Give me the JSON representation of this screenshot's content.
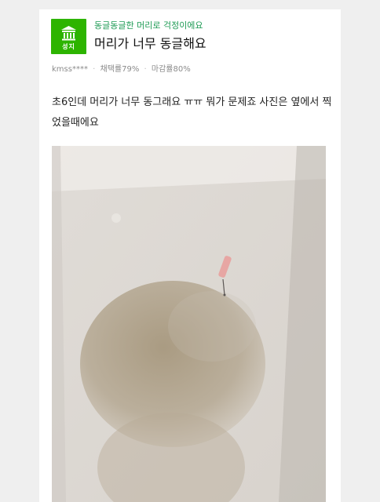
{
  "question": {
    "category": "동글동글한 머리로 걱정이에요",
    "title": "머리가 너무 동글해요",
    "author": "kmss****",
    "stats": {
      "adoption_rate": "채택률79%",
      "deadline_rate": "마감률80%"
    },
    "body": "초6인데 머리가 너무 동그래요 ㅠㅠ 뭐가 문제죠 사진은 옆에서 찍었을때에요"
  },
  "badge": {
    "label": "성지",
    "color": "#2db400",
    "icon": "temple-icon"
  },
  "photo": {
    "kind": "blurry-side-photo"
  }
}
